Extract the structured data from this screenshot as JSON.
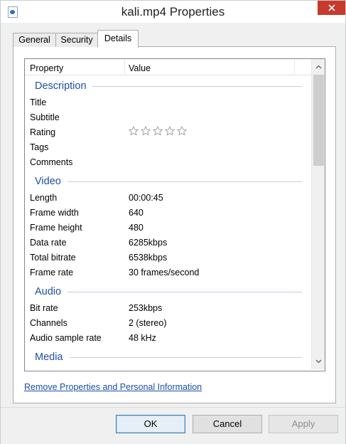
{
  "window": {
    "title": "kali.mp4 Properties"
  },
  "tabs": [
    "General",
    "Security",
    "Details"
  ],
  "active_tab": "Details",
  "columns": {
    "property": "Property",
    "value": "Value"
  },
  "groups": {
    "description": {
      "label": "Description",
      "rows": [
        {
          "property": "Title",
          "value": ""
        },
        {
          "property": "Subtitle",
          "value": ""
        },
        {
          "property": "Rating",
          "value": ""
        },
        {
          "property": "Tags",
          "value": ""
        },
        {
          "property": "Comments",
          "value": ""
        }
      ]
    },
    "video": {
      "label": "Video",
      "rows": [
        {
          "property": "Length",
          "value": "00:00:45"
        },
        {
          "property": "Frame width",
          "value": "640"
        },
        {
          "property": "Frame height",
          "value": "480"
        },
        {
          "property": "Data rate",
          "value": "6285kbps"
        },
        {
          "property": "Total bitrate",
          "value": "6538kbps"
        },
        {
          "property": "Frame rate",
          "value": "30 frames/second"
        }
      ]
    },
    "audio": {
      "label": "Audio",
      "rows": [
        {
          "property": "Bit rate",
          "value": "253kbps"
        },
        {
          "property": "Channels",
          "value": "2 (stereo)"
        },
        {
          "property": "Audio sample rate",
          "value": "48 kHz"
        }
      ]
    },
    "media": {
      "label": "Media"
    }
  },
  "rating": {
    "stars_filled": 0,
    "stars_total": 5
  },
  "link_text": "Remove Properties and Personal Information",
  "buttons": {
    "ok": "OK",
    "cancel": "Cancel",
    "apply": "Apply"
  },
  "colors": {
    "close_button": "#c7392b",
    "group_label": "#1f4fa1",
    "link": "#1a4fa8"
  }
}
